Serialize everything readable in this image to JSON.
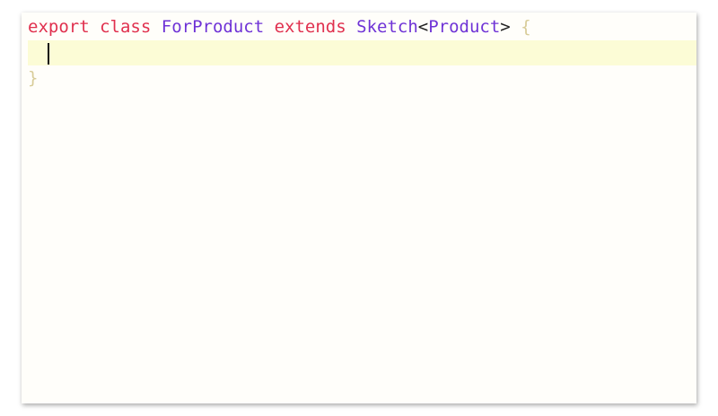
{
  "editor": {
    "line1": {
      "kw_export": "export",
      "kw_class": "class",
      "class_name": "ForProduct",
      "kw_extends": "extends",
      "base": "Sketch",
      "lt": "<",
      "type_arg": "Product",
      "gt": ">",
      "open_brace": "{"
    },
    "line3": {
      "close_brace": "}"
    }
  },
  "colors": {
    "keyword": "#e0304e",
    "type": "#6f33d6",
    "brace": "#d8cc98",
    "current_line": "#fcfcd6"
  }
}
